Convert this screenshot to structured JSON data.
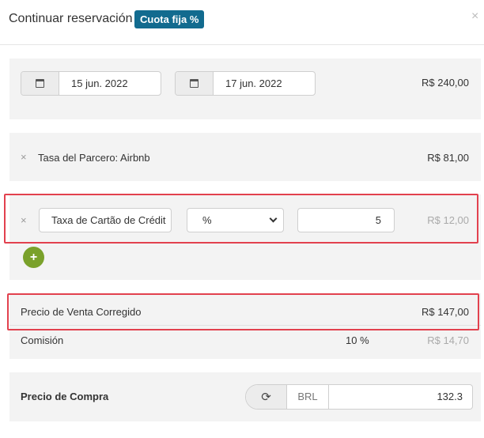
{
  "header": {
    "title": "Continuar reservación",
    "badge": "Cuota fija %",
    "close_icon": "×"
  },
  "dates": {
    "start": "15 jun. 2022",
    "end": "17 jun. 2022",
    "calendar_icon": "calendar-icon",
    "amount": "R$ 240,00"
  },
  "partner_fee": {
    "remove_icon": "×",
    "label": "Tasa del Parcero: Airbnb",
    "amount": "R$ 81,00"
  },
  "extra_fee": {
    "remove_icon": "×",
    "name_value": "Taxa de Cartão de Crédit",
    "type_value": "%",
    "value": "5",
    "amount": "R$ 12,00",
    "add_icon": "+"
  },
  "corrected_price": {
    "label": "Precio de Venta Corregido",
    "amount": "R$ 147,00"
  },
  "commission": {
    "label": "Comisión",
    "percent": "10 %",
    "amount": "R$ 14,70"
  },
  "purchase": {
    "label": "Precio de Compra",
    "refresh_icon": "⟳",
    "currency": "BRL",
    "value": "132.3"
  },
  "colors": {
    "badge": "#126b8f",
    "add_button": "#7aa12b",
    "highlight": "#e2414e"
  }
}
